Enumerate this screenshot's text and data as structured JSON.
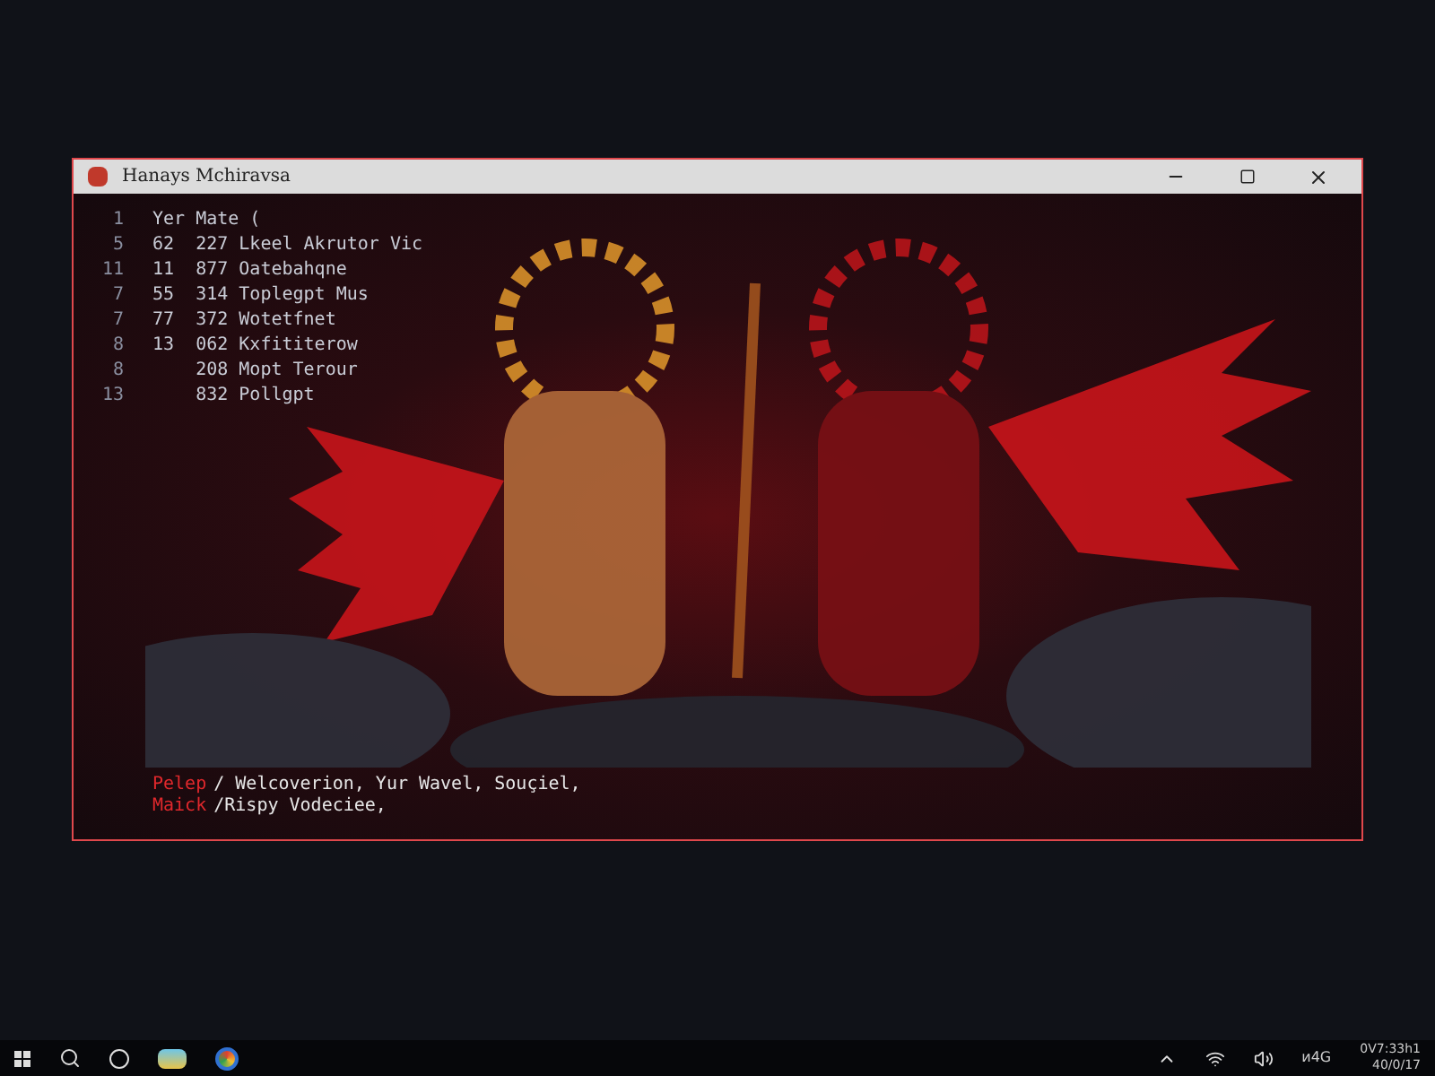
{
  "window": {
    "title": "Hanays Mchiravsa"
  },
  "code_lines": [
    {
      "number": "1",
      "text": "Yer Mate ("
    },
    {
      "number": "5",
      "text": "62  227 Lkeel Akrutor Vic"
    },
    {
      "number": "11",
      "text": "11  877 Oatebahqne"
    },
    {
      "number": "7",
      "text": "55  314 Toplegpt Mus"
    },
    {
      "number": "7",
      "text": "77  372 Wotetfnet"
    },
    {
      "number": "8",
      "text": "13  062 Kxfititerow"
    },
    {
      "number": "8",
      "text": "    208 Mopt Terour"
    },
    {
      "number": "13",
      "text": "    832 Pollgpt"
    }
  ],
  "console": [
    {
      "keyword": "Pelep",
      "text": "/ Welcoverion, Yur Wavel, Souçiel,"
    },
    {
      "keyword": "Maick",
      "text": "/Rispy Vodeciee,"
    }
  ],
  "taskbar": {
    "clock_time": "0V7:33h1",
    "clock_date": "40/0/17",
    "tray_text": "ᴎ4G"
  }
}
